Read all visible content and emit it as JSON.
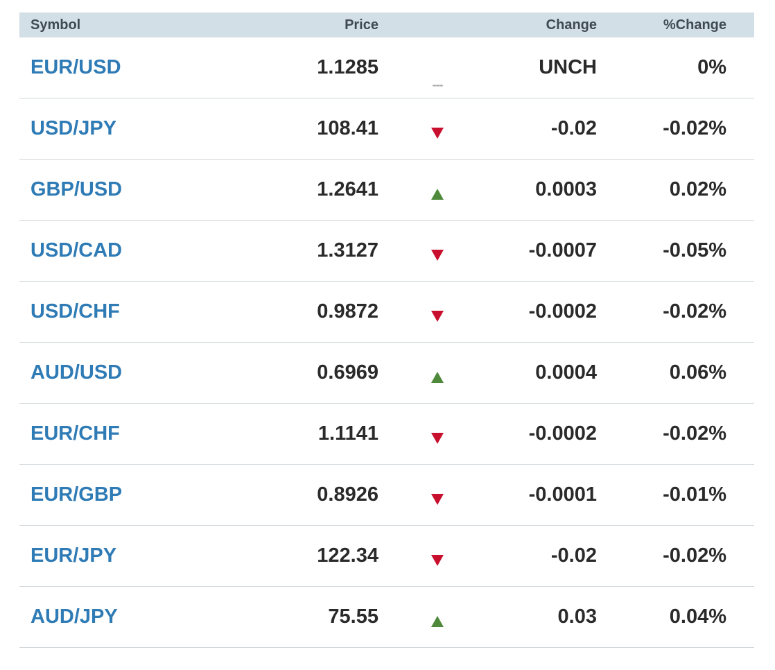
{
  "header": {
    "symbol": "Symbol",
    "price": "Price",
    "change": "Change",
    "pct_change": "%Change"
  },
  "colors": {
    "up": "#4f8a3c",
    "down": "#c8102e",
    "link": "#2f7bb5"
  },
  "rows": [
    {
      "symbol": "EUR/USD",
      "price": "1.1285",
      "direction": "unch",
      "change": "UNCH",
      "pct": "0%"
    },
    {
      "symbol": "USD/JPY",
      "price": "108.41",
      "direction": "down",
      "change": "-0.02",
      "pct": "-0.02%"
    },
    {
      "symbol": "GBP/USD",
      "price": "1.2641",
      "direction": "up",
      "change": "0.0003",
      "pct": "0.02%"
    },
    {
      "symbol": "USD/CAD",
      "price": "1.3127",
      "direction": "down",
      "change": "-0.0007",
      "pct": "-0.05%"
    },
    {
      "symbol": "USD/CHF",
      "price": "0.9872",
      "direction": "down",
      "change": "-0.0002",
      "pct": "-0.02%"
    },
    {
      "symbol": "AUD/USD",
      "price": "0.6969",
      "direction": "up",
      "change": "0.0004",
      "pct": "0.06%"
    },
    {
      "symbol": "EUR/CHF",
      "price": "1.1141",
      "direction": "down",
      "change": "-0.0002",
      "pct": "-0.02%"
    },
    {
      "symbol": "EUR/GBP",
      "price": "0.8926",
      "direction": "down",
      "change": "-0.0001",
      "pct": "-0.01%"
    },
    {
      "symbol": "EUR/JPY",
      "price": "122.34",
      "direction": "down",
      "change": "-0.02",
      "pct": "-0.02%"
    },
    {
      "symbol": "AUD/JPY",
      "price": "75.55",
      "direction": "up",
      "change": "0.03",
      "pct": "0.04%"
    }
  ],
  "unch_marker": "---"
}
